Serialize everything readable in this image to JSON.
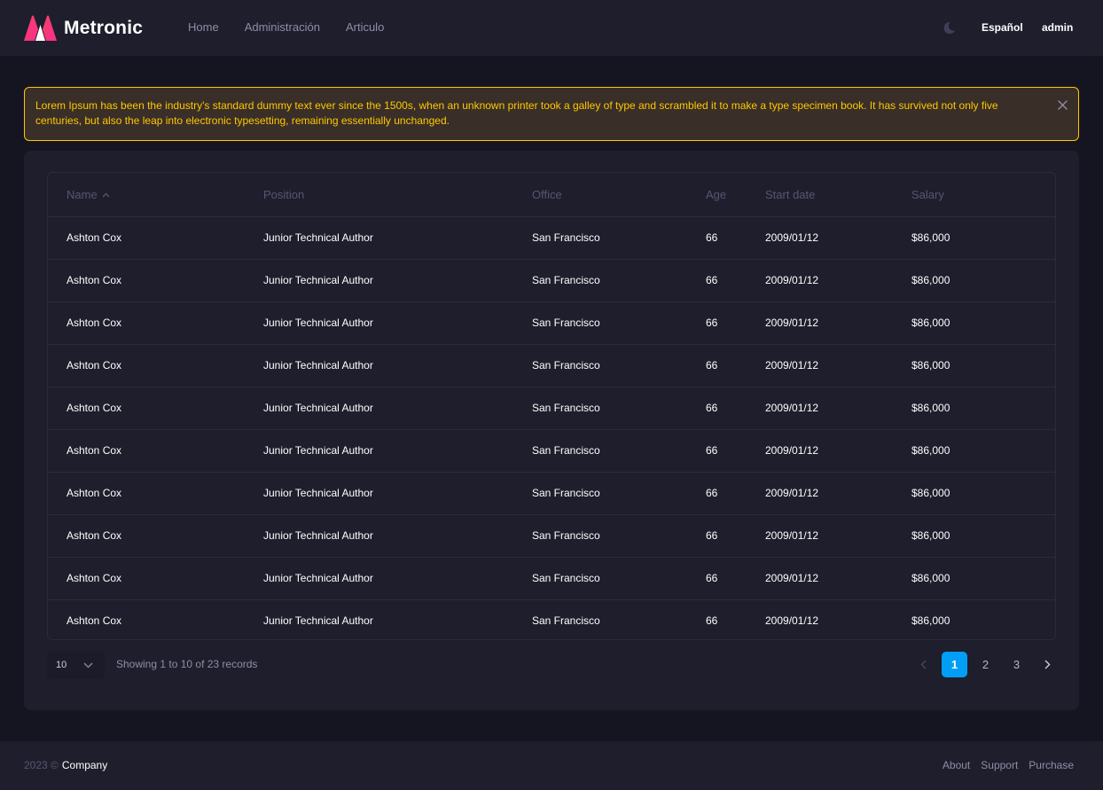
{
  "header": {
    "brand": "Metronic",
    "nav": [
      "Home",
      "Administración",
      "Articulo"
    ],
    "language": "Español",
    "user": "admin"
  },
  "alert": {
    "text": "Lorem Ipsum has been the industry's standard dummy text ever since the 1500s, when an unknown printer took a galley of type and scrambled it to make a type specimen book. It has survived not only five centuries, but also the leap into electronic typesetting, remaining essentially unchanged."
  },
  "table": {
    "columns": [
      "Name",
      "Position",
      "Office",
      "Age",
      "Start date",
      "Salary"
    ],
    "rows": [
      [
        "Ashton Cox",
        "Junior Technical Author",
        "San Francisco",
        "66",
        "2009/01/12",
        "$86,000"
      ],
      [
        "Ashton Cox",
        "Junior Technical Author",
        "San Francisco",
        "66",
        "2009/01/12",
        "$86,000"
      ],
      [
        "Ashton Cox",
        "Junior Technical Author",
        "San Francisco",
        "66",
        "2009/01/12",
        "$86,000"
      ],
      [
        "Ashton Cox",
        "Junior Technical Author",
        "San Francisco",
        "66",
        "2009/01/12",
        "$86,000"
      ],
      [
        "Ashton Cox",
        "Junior Technical Author",
        "San Francisco",
        "66",
        "2009/01/12",
        "$86,000"
      ],
      [
        "Ashton Cox",
        "Junior Technical Author",
        "San Francisco",
        "66",
        "2009/01/12",
        "$86,000"
      ],
      [
        "Ashton Cox",
        "Junior Technical Author",
        "San Francisco",
        "66",
        "2009/01/12",
        "$86,000"
      ],
      [
        "Ashton Cox",
        "Junior Technical Author",
        "San Francisco",
        "66",
        "2009/01/12",
        "$86,000"
      ],
      [
        "Ashton Cox",
        "Junior Technical Author",
        "San Francisco",
        "66",
        "2009/01/12",
        "$86,000"
      ],
      [
        "Ashton Cox",
        "Junior Technical Author",
        "San Francisco",
        "66",
        "2009/01/12",
        "$86,000"
      ]
    ],
    "page_size": "10",
    "records_info": "Showing 1 to 10 of 23 records",
    "pages": [
      "1",
      "2",
      "3"
    ],
    "active_page": "1"
  },
  "footer": {
    "year": "2023 ©",
    "company": "Company",
    "links": [
      "About",
      "Support",
      "Purchase"
    ]
  },
  "colors": {
    "background": "#151521",
    "surface": "#1e1e2d",
    "warning": "#ffc700",
    "primary": "#009ef7",
    "brand_gradient": [
      "#f1416c",
      "#ff2e8a"
    ]
  },
  "icons": {
    "logo": "metronic-logo-icon",
    "theme": "moon-icon",
    "alert_close": "close-icon",
    "sort": "arrow-up-icon",
    "select": "chevron-down-icon",
    "prev": "chevron-left-icon",
    "next": "chevron-right-icon"
  }
}
